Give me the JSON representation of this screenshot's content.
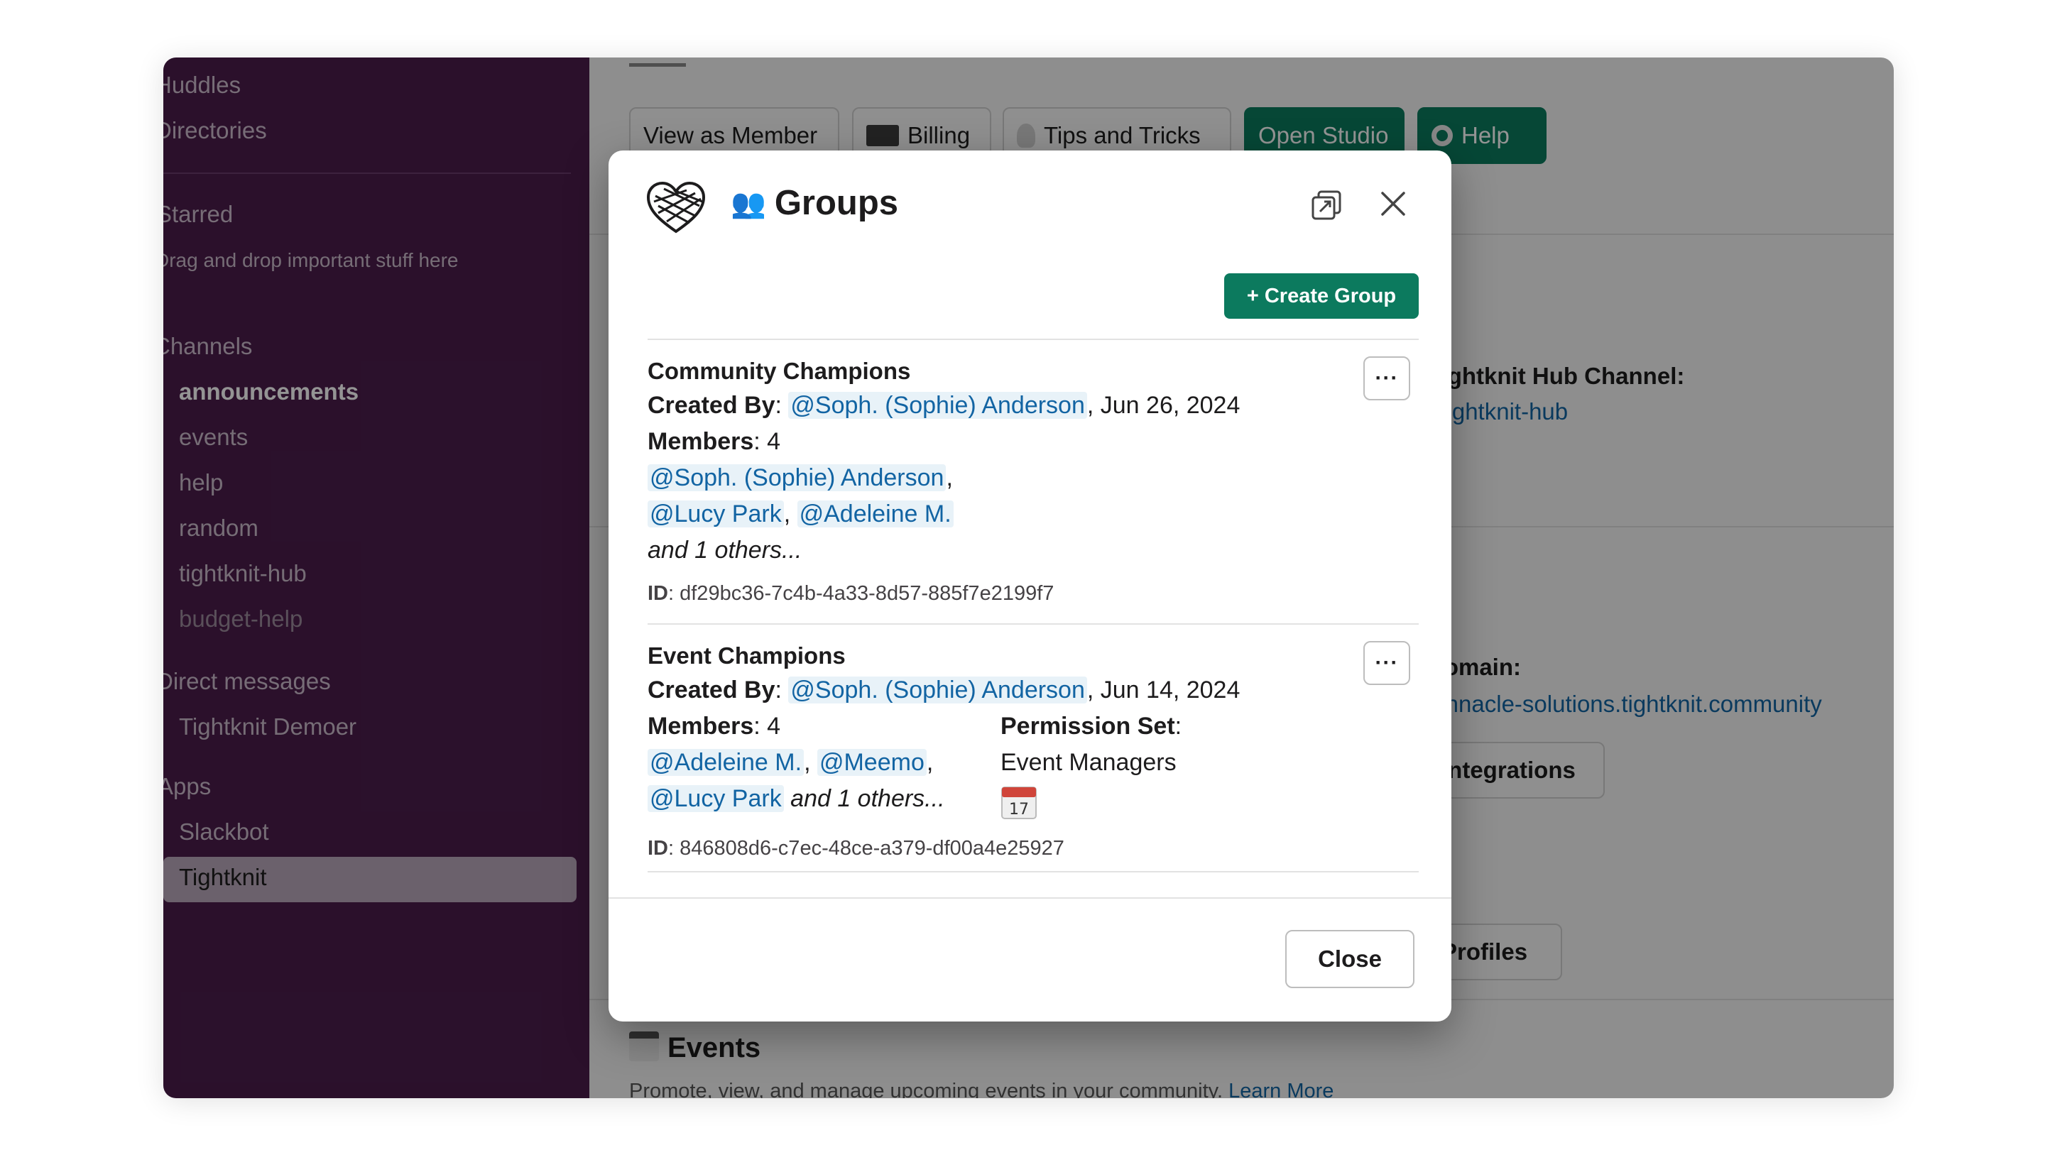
{
  "sidebar": {
    "huddles": "Huddles",
    "directories": "Directories",
    "starred": "Starred",
    "starred_hint": "Drag and drop important stuff here",
    "channels_label": "Channels",
    "channels": [
      "announcements",
      "events",
      "help",
      "random",
      "tightknit-hub",
      "budget-help"
    ],
    "dm_label": "Direct messages",
    "dm_user": "Tightknit Demoer",
    "apps_label": "Apps",
    "apps": [
      "Slackbot",
      "Tightknit"
    ]
  },
  "main": {
    "buttons": {
      "view_as_member": "View as Member",
      "billing": "Billing",
      "tips": "Tips and Tricks",
      "open_studio": "Open Studio",
      "help": "Help"
    },
    "hub_channel_label": "Tightknit Hub Channel:",
    "hub_channel_value": "#tightknit-hub",
    "url_label": "Domain:",
    "url_value": "pinnacle-solutions.tightknit.community",
    "integrations_button": "Integrations",
    "profiles_button": "Profiles",
    "events_title": "Events",
    "events_description": "Promote, view, and manage upcoming events in your community.",
    "events_learn_more": "Learn More"
  },
  "modal": {
    "title": "Groups",
    "create_button": "+ Create Group",
    "close_button": "Close",
    "labels": {
      "created_by": "Created By",
      "members": "Members",
      "permission_set": "Permission Set",
      "id": "ID"
    },
    "groups": [
      {
        "name": "Community Champions",
        "creator": "@Soph. (Sophie) Anderson",
        "date": ", Jun 26, 2024",
        "member_count": ": 4",
        "members": [
          "@Soph. (Sophie) Anderson",
          "@Lucy Park",
          "@Adeleine M."
        ],
        "others": "and 1 others...",
        "id": "df29bc36-7c4b-4a33-8d57-885f7e2199f7"
      },
      {
        "name": "Event Champions",
        "creator": "@Soph. (Sophie) Anderson",
        "date": ", Jun 14, 2024",
        "member_count": ": 4",
        "members": [
          "@Adeleine M.",
          "@Meemo",
          "@Lucy Park"
        ],
        "others": "and 1 others...",
        "permission_set": "Event Managers",
        "calendar_day": "17",
        "id": "846808d6-c7ec-48ce-a379-df00a4e25927"
      }
    ]
  },
  "colors": {
    "sidebar_bg": "#4a1d4b",
    "accent_green": "#0c7a5e",
    "mention_text": "#1264a3",
    "mention_bg": "#e8f2f8"
  }
}
